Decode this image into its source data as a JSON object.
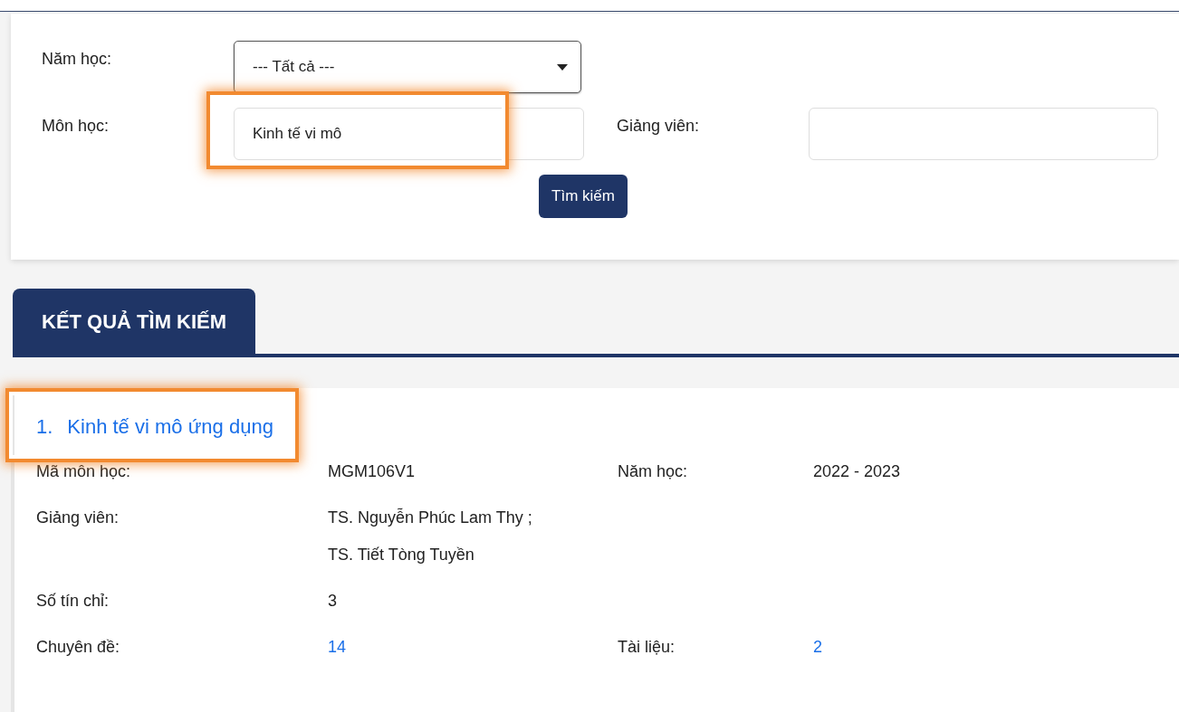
{
  "search_form": {
    "year": {
      "label": "Năm học:",
      "value": "--- Tất cả ---"
    },
    "subject": {
      "label": "Môn học:",
      "value": "Kinh tế vi mô",
      "highlighted": true
    },
    "lecturer": {
      "label": "Giảng viên:"
    },
    "button": "Tìm kiếm"
  },
  "results_tab": {
    "label": "KẾT QUẢ TÌM KIẾM",
    "selected": true
  },
  "results": [
    {
      "number": "1.",
      "title": "Kinh tế vi mô ứng dụng",
      "highlighted": true,
      "fields": [
        {
          "label": "Mã môn học:",
          "values": [
            "MGM106V1"
          ],
          "link": false,
          "label2": "Năm học:",
          "value2": "2022 - 2023",
          "link2": false
        },
        {
          "label": "Giảng viên:",
          "values": [
            "TS. Nguyễn Phúc Lam Thy ;",
            "TS. Tiết Tòng Tuyền"
          ],
          "link": false
        },
        {
          "label": "Số tín chỉ:",
          "values": [
            "3"
          ],
          "link": false
        },
        {
          "label": "Chuyên đề:",
          "values": [
            "14"
          ],
          "link": true,
          "label2": "Tài liệu:",
          "value2": "2",
          "link2": true
        }
      ]
    }
  ]
}
